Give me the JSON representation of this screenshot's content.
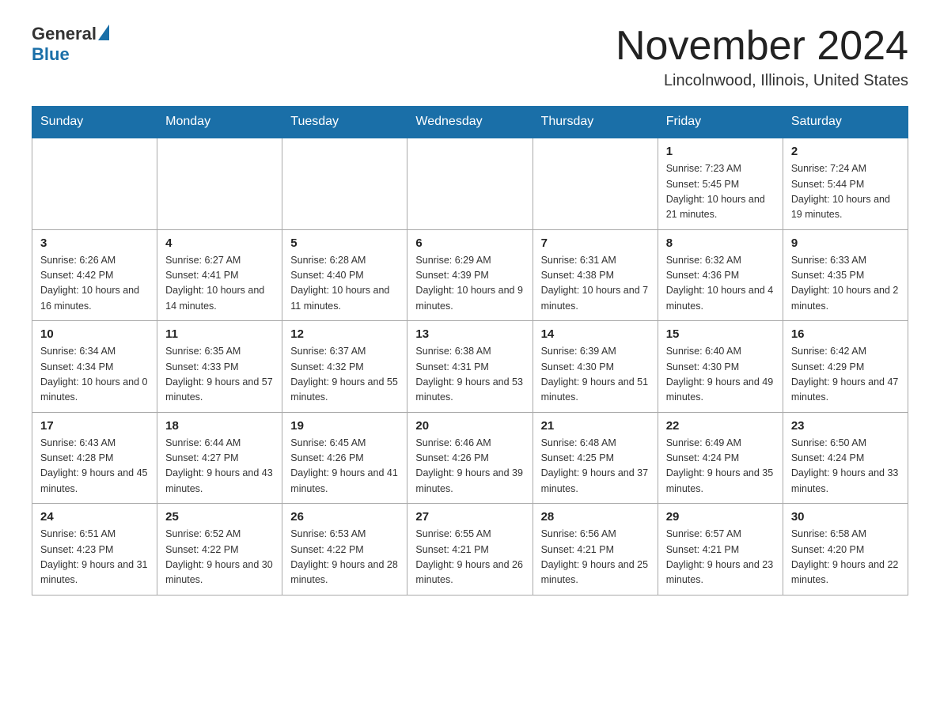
{
  "header": {
    "logo_general": "General",
    "logo_blue": "Blue",
    "title": "November 2024",
    "subtitle": "Lincolnwood, Illinois, United States"
  },
  "weekdays": [
    "Sunday",
    "Monday",
    "Tuesday",
    "Wednesday",
    "Thursday",
    "Friday",
    "Saturday"
  ],
  "weeks": [
    [
      {
        "day": "",
        "sunrise": "",
        "sunset": "",
        "daylight": ""
      },
      {
        "day": "",
        "sunrise": "",
        "sunset": "",
        "daylight": ""
      },
      {
        "day": "",
        "sunrise": "",
        "sunset": "",
        "daylight": ""
      },
      {
        "day": "",
        "sunrise": "",
        "sunset": "",
        "daylight": ""
      },
      {
        "day": "",
        "sunrise": "",
        "sunset": "",
        "daylight": ""
      },
      {
        "day": "1",
        "sunrise": "Sunrise: 7:23 AM",
        "sunset": "Sunset: 5:45 PM",
        "daylight": "Daylight: 10 hours and 21 minutes."
      },
      {
        "day": "2",
        "sunrise": "Sunrise: 7:24 AM",
        "sunset": "Sunset: 5:44 PM",
        "daylight": "Daylight: 10 hours and 19 minutes."
      }
    ],
    [
      {
        "day": "3",
        "sunrise": "Sunrise: 6:26 AM",
        "sunset": "Sunset: 4:42 PM",
        "daylight": "Daylight: 10 hours and 16 minutes."
      },
      {
        "day": "4",
        "sunrise": "Sunrise: 6:27 AM",
        "sunset": "Sunset: 4:41 PM",
        "daylight": "Daylight: 10 hours and 14 minutes."
      },
      {
        "day": "5",
        "sunrise": "Sunrise: 6:28 AM",
        "sunset": "Sunset: 4:40 PM",
        "daylight": "Daylight: 10 hours and 11 minutes."
      },
      {
        "day": "6",
        "sunrise": "Sunrise: 6:29 AM",
        "sunset": "Sunset: 4:39 PM",
        "daylight": "Daylight: 10 hours and 9 minutes."
      },
      {
        "day": "7",
        "sunrise": "Sunrise: 6:31 AM",
        "sunset": "Sunset: 4:38 PM",
        "daylight": "Daylight: 10 hours and 7 minutes."
      },
      {
        "day": "8",
        "sunrise": "Sunrise: 6:32 AM",
        "sunset": "Sunset: 4:36 PM",
        "daylight": "Daylight: 10 hours and 4 minutes."
      },
      {
        "day": "9",
        "sunrise": "Sunrise: 6:33 AM",
        "sunset": "Sunset: 4:35 PM",
        "daylight": "Daylight: 10 hours and 2 minutes."
      }
    ],
    [
      {
        "day": "10",
        "sunrise": "Sunrise: 6:34 AM",
        "sunset": "Sunset: 4:34 PM",
        "daylight": "Daylight: 10 hours and 0 minutes."
      },
      {
        "day": "11",
        "sunrise": "Sunrise: 6:35 AM",
        "sunset": "Sunset: 4:33 PM",
        "daylight": "Daylight: 9 hours and 57 minutes."
      },
      {
        "day": "12",
        "sunrise": "Sunrise: 6:37 AM",
        "sunset": "Sunset: 4:32 PM",
        "daylight": "Daylight: 9 hours and 55 minutes."
      },
      {
        "day": "13",
        "sunrise": "Sunrise: 6:38 AM",
        "sunset": "Sunset: 4:31 PM",
        "daylight": "Daylight: 9 hours and 53 minutes."
      },
      {
        "day": "14",
        "sunrise": "Sunrise: 6:39 AM",
        "sunset": "Sunset: 4:30 PM",
        "daylight": "Daylight: 9 hours and 51 minutes."
      },
      {
        "day": "15",
        "sunrise": "Sunrise: 6:40 AM",
        "sunset": "Sunset: 4:30 PM",
        "daylight": "Daylight: 9 hours and 49 minutes."
      },
      {
        "day": "16",
        "sunrise": "Sunrise: 6:42 AM",
        "sunset": "Sunset: 4:29 PM",
        "daylight": "Daylight: 9 hours and 47 minutes."
      }
    ],
    [
      {
        "day": "17",
        "sunrise": "Sunrise: 6:43 AM",
        "sunset": "Sunset: 4:28 PM",
        "daylight": "Daylight: 9 hours and 45 minutes."
      },
      {
        "day": "18",
        "sunrise": "Sunrise: 6:44 AM",
        "sunset": "Sunset: 4:27 PM",
        "daylight": "Daylight: 9 hours and 43 minutes."
      },
      {
        "day": "19",
        "sunrise": "Sunrise: 6:45 AM",
        "sunset": "Sunset: 4:26 PM",
        "daylight": "Daylight: 9 hours and 41 minutes."
      },
      {
        "day": "20",
        "sunrise": "Sunrise: 6:46 AM",
        "sunset": "Sunset: 4:26 PM",
        "daylight": "Daylight: 9 hours and 39 minutes."
      },
      {
        "day": "21",
        "sunrise": "Sunrise: 6:48 AM",
        "sunset": "Sunset: 4:25 PM",
        "daylight": "Daylight: 9 hours and 37 minutes."
      },
      {
        "day": "22",
        "sunrise": "Sunrise: 6:49 AM",
        "sunset": "Sunset: 4:24 PM",
        "daylight": "Daylight: 9 hours and 35 minutes."
      },
      {
        "day": "23",
        "sunrise": "Sunrise: 6:50 AM",
        "sunset": "Sunset: 4:24 PM",
        "daylight": "Daylight: 9 hours and 33 minutes."
      }
    ],
    [
      {
        "day": "24",
        "sunrise": "Sunrise: 6:51 AM",
        "sunset": "Sunset: 4:23 PM",
        "daylight": "Daylight: 9 hours and 31 minutes."
      },
      {
        "day": "25",
        "sunrise": "Sunrise: 6:52 AM",
        "sunset": "Sunset: 4:22 PM",
        "daylight": "Daylight: 9 hours and 30 minutes."
      },
      {
        "day": "26",
        "sunrise": "Sunrise: 6:53 AM",
        "sunset": "Sunset: 4:22 PM",
        "daylight": "Daylight: 9 hours and 28 minutes."
      },
      {
        "day": "27",
        "sunrise": "Sunrise: 6:55 AM",
        "sunset": "Sunset: 4:21 PM",
        "daylight": "Daylight: 9 hours and 26 minutes."
      },
      {
        "day": "28",
        "sunrise": "Sunrise: 6:56 AM",
        "sunset": "Sunset: 4:21 PM",
        "daylight": "Daylight: 9 hours and 25 minutes."
      },
      {
        "day": "29",
        "sunrise": "Sunrise: 6:57 AM",
        "sunset": "Sunset: 4:21 PM",
        "daylight": "Daylight: 9 hours and 23 minutes."
      },
      {
        "day": "30",
        "sunrise": "Sunrise: 6:58 AM",
        "sunset": "Sunset: 4:20 PM",
        "daylight": "Daylight: 9 hours and 22 minutes."
      }
    ]
  ]
}
